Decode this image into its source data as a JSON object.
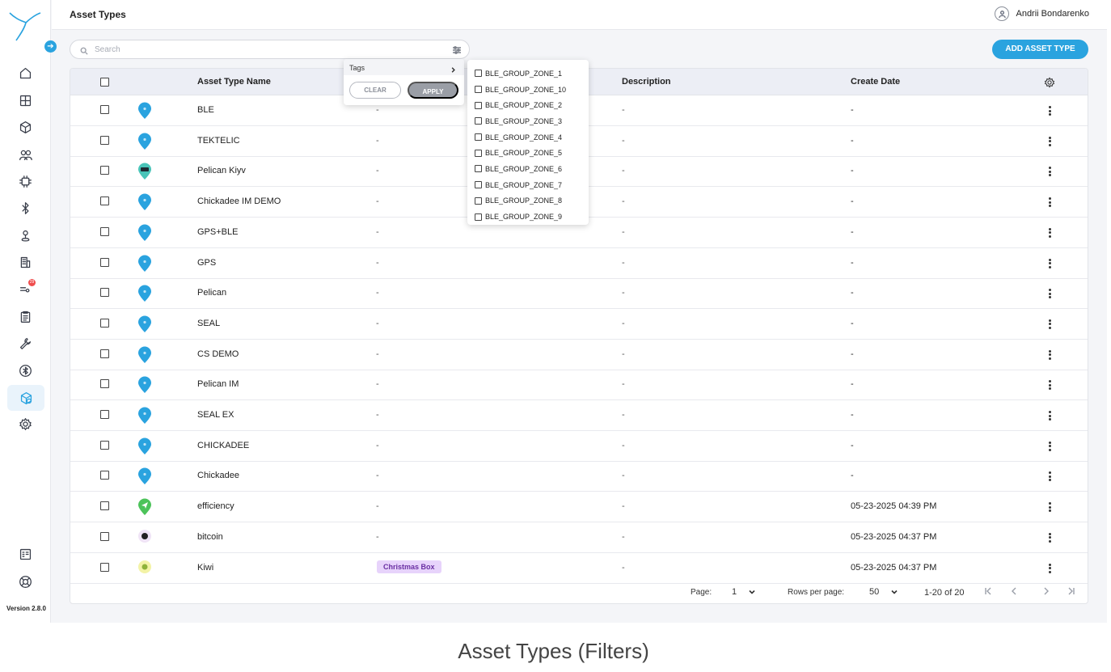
{
  "header": {
    "title": "Asset Types",
    "user_name": "Andrii Bondarenko"
  },
  "search": {
    "placeholder": "Search"
  },
  "actions": {
    "add_label": "ADD ASSET TYPE"
  },
  "table": {
    "columns": {
      "name": "Asset Type Name",
      "description": "Description",
      "create_date": "Create Date"
    },
    "rows": [
      {
        "name": "BLE",
        "tags": "-",
        "description": "-",
        "create_date": "-",
        "icon": "map-pin-icon"
      },
      {
        "name": "TEKTELIC",
        "tags": "-",
        "description": "-",
        "create_date": "-",
        "icon": "map-pin-icon"
      },
      {
        "name": "Pelican Kiyv",
        "tags": "-",
        "description": "-",
        "create_date": "-",
        "icon": "device-pin-icon"
      },
      {
        "name": "Chickadee IM DEMO",
        "tags": "-",
        "description": "-",
        "create_date": "-",
        "icon": "map-pin-icon"
      },
      {
        "name": "GPS+BLE",
        "tags": "-",
        "description": "-",
        "create_date": "-",
        "icon": "map-pin-icon"
      },
      {
        "name": "GPS",
        "tags": "-",
        "description": "-",
        "create_date": "-",
        "icon": "map-pin-icon"
      },
      {
        "name": "Pelican",
        "tags": "-",
        "description": "-",
        "create_date": "-",
        "icon": "map-pin-icon"
      },
      {
        "name": "SEAL",
        "tags": "-",
        "description": "-",
        "create_date": "-",
        "icon": "map-pin-icon"
      },
      {
        "name": "CS DEMO",
        "tags": "-",
        "description": "-",
        "create_date": "-",
        "icon": "map-pin-icon"
      },
      {
        "name": "Pelican IM",
        "tags": "-",
        "description": "-",
        "create_date": "-",
        "icon": "map-pin-icon"
      },
      {
        "name": "SEAL EX",
        "tags": "-",
        "description": "-",
        "create_date": "-",
        "icon": "map-pin-icon"
      },
      {
        "name": "CHICKADEE",
        "tags": "-",
        "description": "-",
        "create_date": "-",
        "icon": "map-pin-icon"
      },
      {
        "name": "Chickadee",
        "tags": "-",
        "description": "-",
        "create_date": "-",
        "icon": "map-pin-icon"
      },
      {
        "name": "efficiency",
        "tags": "-",
        "description": "-",
        "create_date": "05-23-2025 04:39 PM",
        "icon": "navigation-pin-icon"
      },
      {
        "name": "bitcoin",
        "tags": "-",
        "description": "-",
        "create_date": "05-23-2025 04:37 PM",
        "icon": "bitcoin-pin-icon"
      },
      {
        "name": "Kiwi",
        "tags": "Christmas Box",
        "description": "-",
        "create_date": "05-23-2025 04:37 PM",
        "icon": "kiwi-pin-icon"
      }
    ]
  },
  "pagination": {
    "page_label": "Page:",
    "page_value": "1",
    "rows_label": "Rows per page:",
    "rows_value": "50",
    "range": "1-20 of 20"
  },
  "filter_popup": {
    "tags_label": "Tags",
    "clear_label": "CLEAR",
    "apply_label": "APPLY"
  },
  "tag_options": [
    "BLE_GROUP_ZONE_1",
    "BLE_GROUP_ZONE_10",
    "BLE_GROUP_ZONE_2",
    "BLE_GROUP_ZONE_3",
    "BLE_GROUP_ZONE_4",
    "BLE_GROUP_ZONE_5",
    "BLE_GROUP_ZONE_6",
    "BLE_GROUP_ZONE_7",
    "BLE_GROUP_ZONE_8",
    "BLE_GROUP_ZONE_9"
  ],
  "sidebar": {
    "version": "Version 2.8.0",
    "badge_count": "29"
  },
  "colors": {
    "accent": "#2aa3df",
    "tag_bg": "#e7d3fb",
    "tag_text": "#6a2fa3",
    "badge": "#ef4d4d"
  },
  "caption": "Asset Types (Filters)"
}
